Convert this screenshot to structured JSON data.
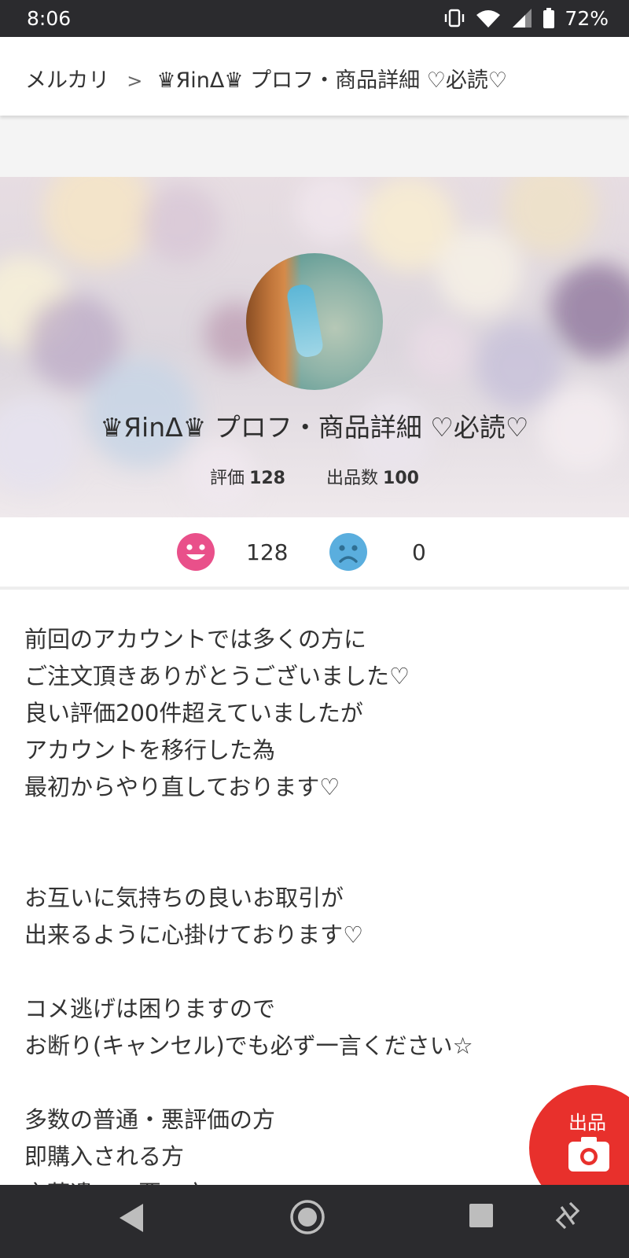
{
  "status_bar": {
    "time": "8:06",
    "battery": "72%",
    "icons": [
      "vibrate-icon",
      "wifi-icon",
      "signal-icon",
      "battery-icon"
    ]
  },
  "breadcrumb": {
    "root": "メルカリ",
    "separator": ">",
    "current": "♛ЯinΔ♛ プロフ・商品詳細 ♡必読♡"
  },
  "profile": {
    "name": "♛ЯinΔ♛ プロフ・商品詳細 ♡必読♡",
    "rating_label": "評価",
    "rating_count": "128",
    "listings_label": "出品数",
    "listings_count": "100"
  },
  "ratings": {
    "good_count": "128",
    "bad_count": "0",
    "good_color": "#e9508a",
    "bad_color": "#5aaede"
  },
  "description": {
    "lines": [
      "前回のアカウントでは多くの方に",
      "ご注文頂きありがとうございました♡",
      "良い評価200件超えていましたが",
      "アカウントを移行した為",
      "最初からやり直しております♡",
      "",
      "",
      "お互いに気持ちの良いお取引が",
      "出来るように心掛けております♡",
      "",
      "コメ逃げは困りますので",
      "お断り(キャンセル)でも必ず一言ください☆",
      "",
      "多数の普通・悪評価の方",
      "即購入される方",
      "言葉遣いの悪い方"
    ]
  },
  "fab": {
    "label": "出品",
    "color": "#e8302c",
    "icon": "camera-icon"
  },
  "nav": {
    "icons": [
      "back-icon",
      "home-icon",
      "recents-icon",
      "rotate-icon"
    ]
  }
}
